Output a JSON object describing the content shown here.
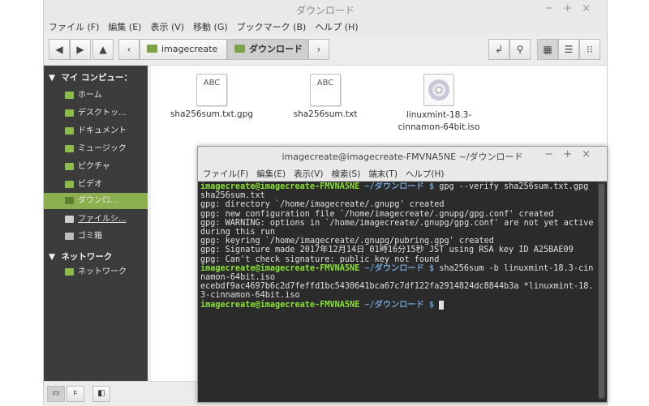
{
  "fm": {
    "title": "ダウンロード",
    "menu": [
      "ファイル (F)",
      "編集 (E)",
      "表示 (V)",
      "移動 (G)",
      "ブックマーク (B)",
      "ヘルプ (H)"
    ],
    "crumbs": [
      "imagecreate",
      "ダウンロード"
    ],
    "sidebar": {
      "section1": "マイ コンピュー：",
      "items": [
        "ホーム",
        "デスクトッ...",
        "ドキュメント",
        "ミュージック",
        "ピクチャ",
        "ビデオ",
        "ダウンロ...",
        "ファイルシ...",
        "ゴミ箱"
      ],
      "section2": "ネットワーク",
      "items2": [
        "ネットワーク"
      ]
    },
    "files": [
      {
        "icon_text": "ABC",
        "name": "sha256sum.txt.gpg"
      },
      {
        "icon_text": "ABC",
        "name": "sha256sum.txt"
      },
      {
        "name": "linuxmint-18.3-cinnamon-64bit.iso"
      }
    ]
  },
  "term": {
    "title": "imagecreate@imagecreate-FMVNA5NE ~/ダウンロード",
    "menu": [
      "ファイル(F)",
      "編集(E)",
      "表示(V)",
      "検索(S)",
      "端末(T)",
      "ヘルプ(H)"
    ],
    "prompt_user": "imagecreate@imagecreate-FMVNA5NE",
    "prompt_dir": " ~/ダウンロード $",
    "cmd1": " gpg --verify sha256sum.txt.gpg sha256sum.txt",
    "out1": "gpg: directory `/home/imagecreate/.gnupg' created\ngpg: new configuration file `/home/imagecreate/.gnupg/gpg.conf' created\ngpg: WARNING: options in `/home/imagecreate/.gnupg/gpg.conf' are not yet active during this run\ngpg: keyring `/home/imagecreate/.gnupg/pubring.gpg' created\ngpg: Signature made 2017年12月14日 01時16分15秒 JST using RSA key ID A25BAE09\ngpg: Can't check signature: public key not found",
    "cmd2": " sha256sum -b linuxmint-18.3-cinnamon-64bit.iso",
    "out2": "ecebdf9ac4697b6c2d7feffd1bc5430641bca67c7df122fa2914824dc8844b3a *linuxmint-18.3-cinnamon-64bit.iso"
  },
  "colors": {
    "accent": "#8cb04f",
    "prompt_user": "#8ae234",
    "prompt_dir": "#729fcf"
  }
}
